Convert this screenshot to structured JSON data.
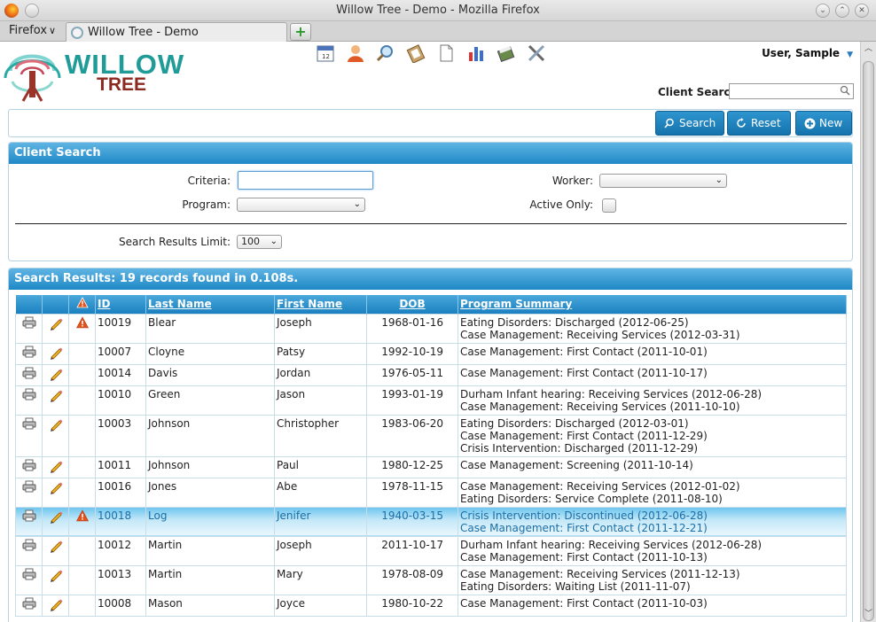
{
  "window": {
    "title": "Willow Tree - Demo - Mozilla Firefox"
  },
  "browser": {
    "menu_label": "Firefox",
    "tab_title": "Willow Tree - Demo",
    "new_tab": "+"
  },
  "logo": {
    "line1": "WILLOW",
    "line2": "TREE"
  },
  "toolbar_icons": [
    "calendar-icon",
    "user-icon",
    "search-magnifier-icon",
    "clipboard-icon",
    "document-icon",
    "chart-icon",
    "book-icon",
    "tools-icon"
  ],
  "user": {
    "name": "User, Sample"
  },
  "header": {
    "client_search_label": "Client Search"
  },
  "actions": {
    "search": "Search",
    "reset": "Reset",
    "new": "New"
  },
  "client_search": {
    "title": "Client Search",
    "criteria_label": "Criteria:",
    "worker_label": "Worker:",
    "program_label": "Program:",
    "active_only_label": "Active Only:",
    "limit_label": "Search Results Limit:",
    "limit_value": "100"
  },
  "results": {
    "title": "Search Results: 19 records found in 0.108s.",
    "columns": {
      "id": "ID",
      "last": "Last Name",
      "first": "First Name",
      "dob": "DOB",
      "program": "Program Summary"
    },
    "rows": [
      {
        "id": "10019",
        "last": "Blear",
        "first": "Joseph",
        "dob": "1968-01-16",
        "alert": true,
        "programs": [
          "Eating Disorders: Discharged (2012-06-25)",
          "Case Management: Receiving Services (2012-03-31)"
        ]
      },
      {
        "id": "10007",
        "last": "Cloyne",
        "first": "Patsy",
        "dob": "1992-10-19",
        "alert": false,
        "programs": [
          "Case Management: First Contact (2011-10-01)"
        ]
      },
      {
        "id": "10014",
        "last": "Davis",
        "first": "Jordan",
        "dob": "1976-05-11",
        "alert": false,
        "programs": [
          "Case Management: First Contact (2011-10-17)"
        ]
      },
      {
        "id": "10010",
        "last": "Green",
        "first": "Jason",
        "dob": "1993-01-19",
        "alert": false,
        "programs": [
          "Durham Infant hearing: Receiving Services (2012-06-28)",
          "Case Management: Receiving Services (2011-10-10)"
        ]
      },
      {
        "id": "10003",
        "last": "Johnson",
        "first": "Christopher",
        "dob": "1983-06-20",
        "alert": false,
        "programs": [
          "Eating Disorders: Discharged (2012-03-01)",
          "Case Management: First Contact (2011-12-29)",
          "Crisis Intervention: Discharged (2011-12-29)"
        ]
      },
      {
        "id": "10011",
        "last": "Johnson",
        "first": "Paul",
        "dob": "1980-12-25",
        "alert": false,
        "programs": [
          "Case Management: Screening (2011-10-14)"
        ]
      },
      {
        "id": "10016",
        "last": "Jones",
        "first": "Abe",
        "dob": "1978-11-15",
        "alert": false,
        "programs": [
          "Case Management: Receiving Services (2012-01-02)",
          "Eating Disorders: Service Complete (2011-08-10)"
        ]
      },
      {
        "id": "10018",
        "last": "Log",
        "first": "Jenifer",
        "dob": "1940-03-15",
        "alert": true,
        "selected": true,
        "programs": [
          "Crisis Intervention: Discontinued (2012-06-28)",
          "Case Management: First Contact (2011-12-21)"
        ]
      },
      {
        "id": "10012",
        "last": "Martin",
        "first": "Joseph",
        "dob": "2011-10-17",
        "alert": false,
        "programs": [
          "Durham Infant hearing: Receiving Services (2012-06-28)",
          "Case Management: First Contact (2011-10-13)"
        ]
      },
      {
        "id": "10013",
        "last": "Martin",
        "first": "Mary",
        "dob": "1978-08-09",
        "alert": false,
        "programs": [
          "Case Management: Receiving Services (2011-12-13)",
          "Eating Disorders: Waiting List (2011-11-07)"
        ]
      },
      {
        "id": "10008",
        "last": "Mason",
        "first": "Joyce",
        "dob": "1980-10-22",
        "alert": false,
        "programs": [
          "Case Management: First Contact (2011-10-03)"
        ]
      }
    ]
  },
  "colors": {
    "accent": "#1e88c6",
    "logo_teal": "#1f9c97",
    "logo_red": "#8c2a22",
    "alert": "#e0531c"
  }
}
